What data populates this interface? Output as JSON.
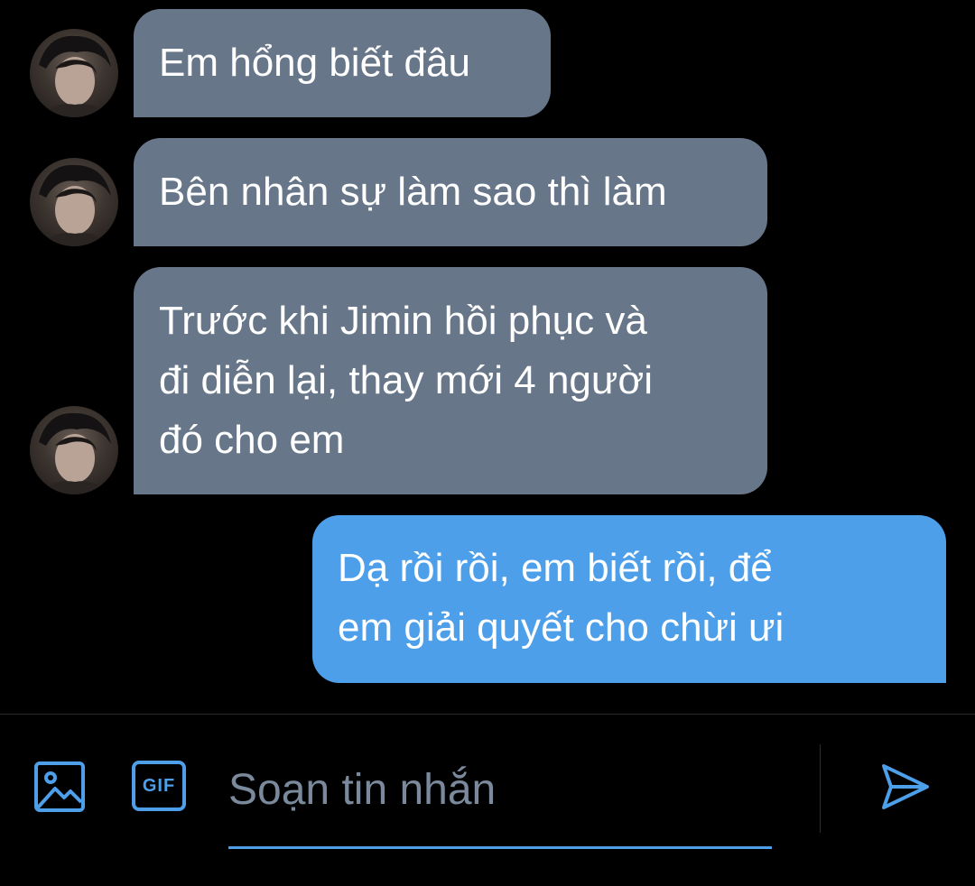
{
  "messages": [
    {
      "direction": "incoming",
      "text": "Em hổng biết đâu"
    },
    {
      "direction": "incoming",
      "text": "Bên nhân sự làm sao thì làm"
    },
    {
      "direction": "incoming",
      "text": "Trước khi Jimin hồi phục và\nđi diễn lại, thay mới 4 người\nđó cho em"
    },
    {
      "direction": "outgoing",
      "text": "Dạ rồi rồi, em biết rồi, để\nem giải quyết cho chừi ưi"
    }
  ],
  "composer": {
    "placeholder": "Soạn tin nhắn",
    "value": "",
    "gif_label": "GIF",
    "image_icon": "image-icon",
    "gif_icon": "gif-icon",
    "send_icon": "send-icon"
  },
  "colors": {
    "background": "#000000",
    "incoming_bubble": "#677689",
    "outgoing_bubble": "#4d9fea",
    "accent": "#4d9fea",
    "placeholder": "#7a8a9c"
  }
}
